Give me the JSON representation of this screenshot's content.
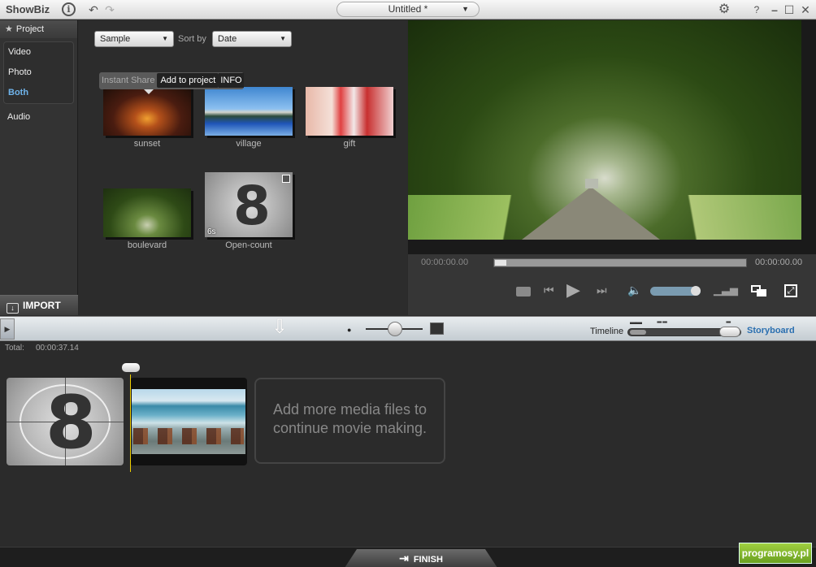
{
  "app": {
    "name": "ShowBiz",
    "project_title": "Untitled *"
  },
  "sidebar": {
    "header": "Project",
    "items": [
      {
        "label": "Video"
      },
      {
        "label": "Photo"
      },
      {
        "label": "Both",
        "active": true
      },
      {
        "label": "Audio"
      }
    ],
    "import_label": "IMPORT"
  },
  "browser": {
    "filter_value": "Sample",
    "sort_label": "Sort by",
    "sort_value": "Date",
    "hover_actions": [
      "Instant Share",
      "Add to project",
      "INFO"
    ],
    "media": [
      {
        "label": "sunset"
      },
      {
        "label": "village"
      },
      {
        "label": "gift"
      },
      {
        "label": "boulevard"
      },
      {
        "label": "Open-count",
        "duration": "6s"
      }
    ]
  },
  "player": {
    "current_time": "00:00:00.00",
    "total_time": "00:00:00.00",
    "progress": 0,
    "volume": 1.0
  },
  "toolbar": {
    "timeline_label": "Timeline",
    "storyboard_label": "Storyboard",
    "zoom_level": 0.5
  },
  "storyboard": {
    "total_label": "Total:",
    "total_value": "00:00:37.14",
    "add_more_text": "Add more media files to continue movie making."
  },
  "footer": {
    "finish_label": "FINISH",
    "watermark": "programosy.pl"
  },
  "colors": {
    "accent": "#6fb3ea",
    "storyboard_link": "#2a6fb0",
    "playhead": "#f0d000"
  }
}
